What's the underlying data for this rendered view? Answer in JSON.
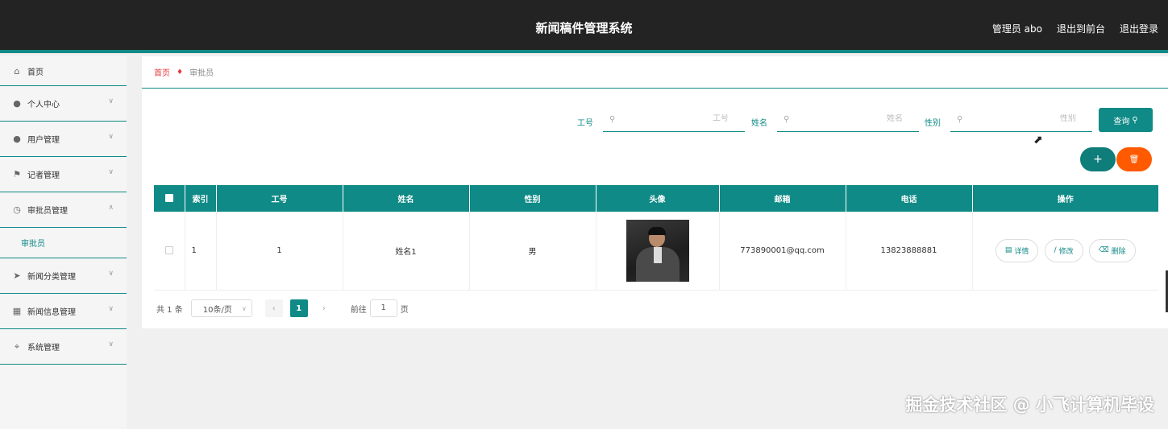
{
  "header": {
    "title": "新闻稿件管理系统",
    "user": "管理员 abo",
    "back_to_front": "退出到前台",
    "logout": "退出登录"
  },
  "sidebar": {
    "items": [
      {
        "label": "首页",
        "icon": "home-icon"
      },
      {
        "label": "个人中心",
        "icon": "user-icon"
      },
      {
        "label": "用户管理",
        "icon": "user-icon"
      },
      {
        "label": "记者管理",
        "icon": "flag-icon"
      },
      {
        "label": "审批员管理",
        "icon": "clock-icon"
      },
      {
        "label": "新闻分类管理",
        "icon": "send-icon"
      },
      {
        "label": "新闻信息管理",
        "icon": "news-icon"
      },
      {
        "label": "系统管理",
        "icon": "crop-icon"
      }
    ],
    "submenu_active": "审批员"
  },
  "breadcrumb": {
    "home": "首页",
    "current": "审批员"
  },
  "search": {
    "fields": [
      {
        "label": "工号",
        "placeholder": "工号"
      },
      {
        "label": "姓名",
        "placeholder": "姓名"
      },
      {
        "label": "性别",
        "placeholder": "性别"
      }
    ],
    "query_label": "查询"
  },
  "actions": {
    "add_symbol": "+",
    "delete_symbol": "🗑"
  },
  "table": {
    "columns": [
      "索引",
      "工号",
      "姓名",
      "性别",
      "头像",
      "邮箱",
      "电话",
      "操作"
    ],
    "rows": [
      {
        "index": "1",
        "job_no": "1",
        "name": "姓名1",
        "gender": "男",
        "email": "773890001@qq.com",
        "phone": "13823888881"
      }
    ],
    "op_detail": "详情",
    "op_edit": "修改",
    "op_delete": "删除"
  },
  "pagination": {
    "total": "共 1 条",
    "page_size": "10条/页",
    "current_page": "1",
    "goto_label": "前往",
    "goto_value": "1",
    "page_unit": "页"
  },
  "watermark": "掘金技术社区 @ 小飞计算机毕设",
  "colors": {
    "accent": "#0f8a86",
    "header_bg": "#232323",
    "danger": "#ff5a00",
    "breadcrumb_home": "#e4393c"
  }
}
